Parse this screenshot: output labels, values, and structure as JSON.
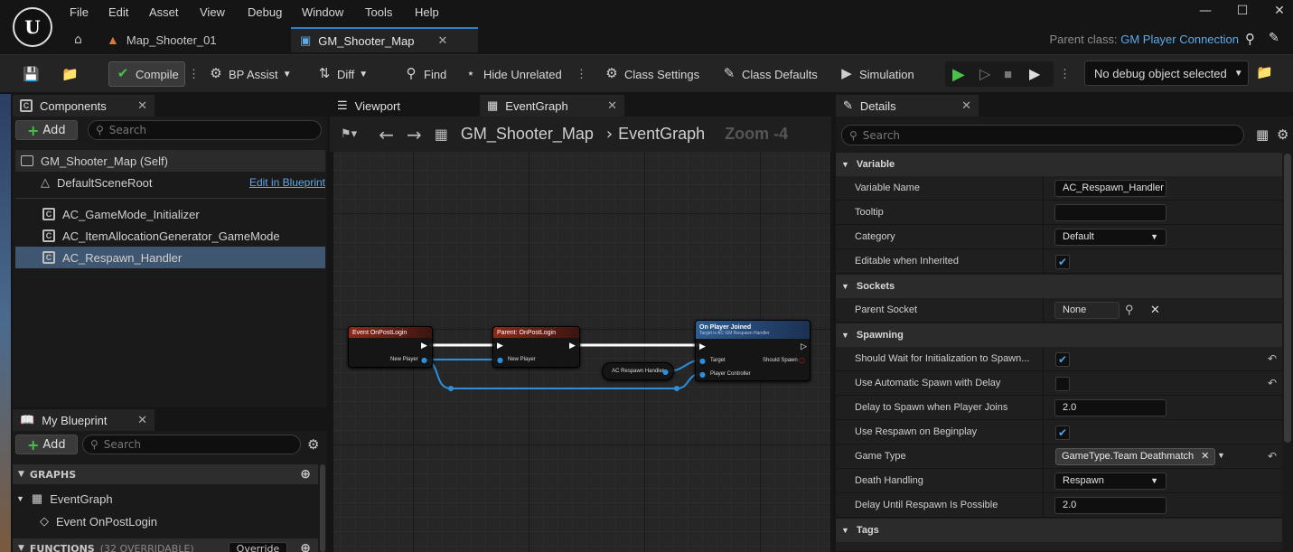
{
  "menu": [
    "File",
    "Edit",
    "Asset",
    "View",
    "Debug",
    "Window",
    "Tools",
    "Help"
  ],
  "tabs": [
    {
      "label": "Map_Shooter_01"
    },
    {
      "label": "GM_Shooter_Map"
    }
  ],
  "parent_class": {
    "label": "Parent class:",
    "value": "GM Player Connection"
  },
  "toolbar": {
    "compile": "Compile",
    "bp_assist": "BP Assist",
    "diff": "Diff",
    "find": "Find",
    "hide_unrelated": "Hide Unrelated",
    "class_settings": "Class Settings",
    "class_defaults": "Class Defaults",
    "simulation": "Simulation",
    "debug_object": "No debug object selected"
  },
  "components": {
    "title": "Components",
    "add": "Add",
    "search_placeholder": "Search",
    "self": "GM_Shooter_Map (Self)",
    "root": "DefaultSceneRoot",
    "edit_link": "Edit in Blueprint",
    "items": [
      "AC_GameMode_Initializer",
      "AC_ItemAllocationGenerator_GameMode",
      "AC_Respawn_Handler"
    ]
  },
  "my_blueprint": {
    "title": "My Blueprint",
    "add": "Add",
    "search_placeholder": "Search",
    "graphs_label": "GRAPHS",
    "event_graph": "EventGraph",
    "event_item": "Event OnPostLogin",
    "functions_label": "FUNCTIONS",
    "functions_count": "(32 OVERRIDABLE)",
    "override": "Override"
  },
  "graph_tabs": {
    "viewport": "Viewport",
    "event_graph": "EventGraph"
  },
  "graph_header": {
    "blueprint": "GM_Shooter_Map",
    "graph": "EventGraph",
    "zoom": "Zoom -4"
  },
  "nodes": {
    "event": {
      "title": "Event OnPostLogin",
      "pin": "New Player"
    },
    "parent": {
      "title": "Parent: OnPostLogin",
      "pin": "New Player"
    },
    "joined": {
      "title": "On Player Joined",
      "subtitle": "Target is AC GM Respawn Handler",
      "pin_target": "Target",
      "pin_pc": "Player Controller",
      "pin_out": "Should Spawn"
    },
    "var": {
      "title": "AC Respawn Handler"
    }
  },
  "details": {
    "title": "Details",
    "search_placeholder": "Search",
    "cat_variable": "Variable",
    "variable_name_label": "Variable Name",
    "variable_name_value": "AC_Respawn_Handler",
    "tooltip_label": "Tooltip",
    "category_label": "Category",
    "category_value": "Default",
    "editable_label": "Editable when Inherited",
    "cat_sockets": "Sockets",
    "parent_socket_label": "Parent Socket",
    "parent_socket_value": "None",
    "cat_spawning": "Spawning",
    "should_wait_label": "Should Wait for Initialization to Spawn...",
    "auto_spawn_label": "Use Automatic Spawn with Delay",
    "delay_join_label": "Delay to Spawn when Player Joins",
    "delay_join_value": "2.0",
    "respawn_begin_label": "Use Respawn on Beginplay",
    "game_type_label": "Game Type",
    "game_type_value": "GameType.Team Deathmatch",
    "death_label": "Death Handling",
    "death_value": "Respawn",
    "delay_respawn_label": "Delay Until Respawn Is Possible",
    "delay_respawn_value": "2.0",
    "cat_tags": "Tags"
  }
}
